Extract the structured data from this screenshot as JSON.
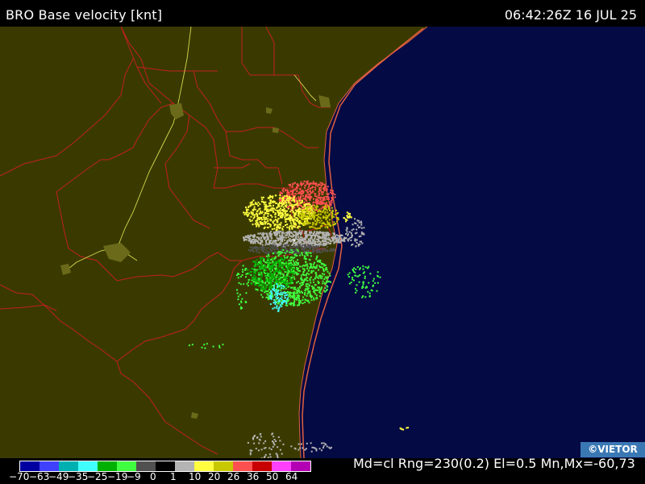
{
  "header": {
    "title": "BRO Base velocity [knt]",
    "timestamp": "06:42:26Z 16 JUL 25"
  },
  "footer": {
    "params": "Md=cl Rng=230(0.2) El=0.5 Mn,Mx=-60,73",
    "credit": "©VIETOR"
  },
  "legend": {
    "colors": [
      "#0000a0",
      "#4040ff",
      "#00b0b0",
      "#40ffff",
      "#00b000",
      "#40ff40",
      "#505050",
      "#000000",
      "#b4b4b4",
      "#ffff40",
      "#c8c800",
      "#ff5050",
      "#c80000",
      "#ff40ff",
      "#b400b4"
    ],
    "ticks": [
      "-70",
      "-63",
      "-49",
      "-35",
      "-25",
      "-19",
      "-9",
      "0",
      "1",
      "10",
      "20",
      "26",
      "36",
      "50",
      "64"
    ]
  },
  "map_colors": {
    "land": "#3a3a00",
    "ocean": "#040a44",
    "county_border": "#c02020",
    "highway": "#d8d850",
    "coast": "#e06040"
  }
}
